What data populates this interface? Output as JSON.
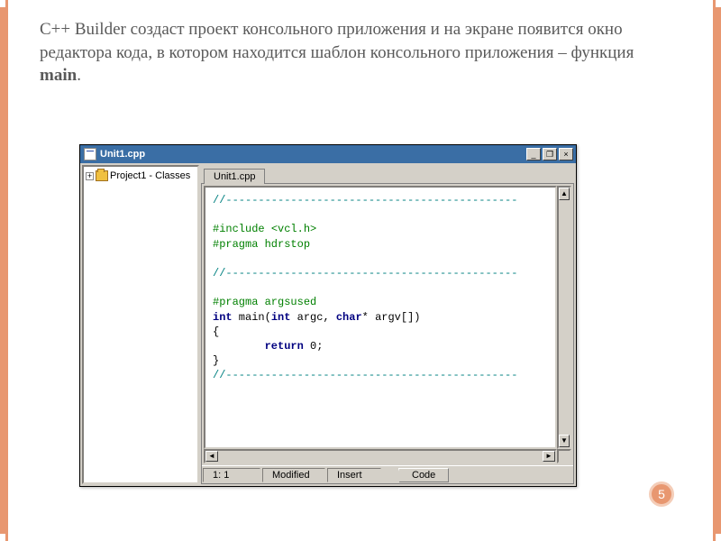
{
  "slide": {
    "paragraph_pre": "C++ Builder создаст проект консольного приложения и на экране появится окно редактора кода, в котором находится шаблон консольного приложения – функция ",
    "paragraph_bold": "main",
    "paragraph_post": "."
  },
  "window": {
    "title": "Unit1.cpp",
    "buttons": {
      "min": "_",
      "max": "❐",
      "close": "×"
    }
  },
  "tree": {
    "root_label": "Project1 - Classes",
    "plus": "+"
  },
  "tabs": {
    "tab1": "Unit1.cpp"
  },
  "code": {
    "l1": "//---------------------------------------------",
    "l2": "",
    "l3a": "#include ",
    "l3b": "<vcl.h>",
    "l4": "#pragma hdrstop",
    "l5": "",
    "l6": "//---------------------------------------------",
    "l7": "",
    "l8": "#pragma argsused",
    "l9a": "int",
    "l9b": " main(",
    "l9c": "int",
    "l9d": " argc, ",
    "l9e": "char",
    "l9f": "* argv[])",
    "l10": "{",
    "l11a": "        ",
    "l11b": "return",
    "l11c": " 0;",
    "l12": "}",
    "l13": "//---------------------------------------------"
  },
  "status": {
    "pos": "1: 1",
    "modified": "Modified",
    "insert": "Insert",
    "bottom_tab": "Code"
  },
  "scroll_glyphs": {
    "up": "▲",
    "down": "▼",
    "left": "◄",
    "right": "►"
  },
  "page_number": "5"
}
